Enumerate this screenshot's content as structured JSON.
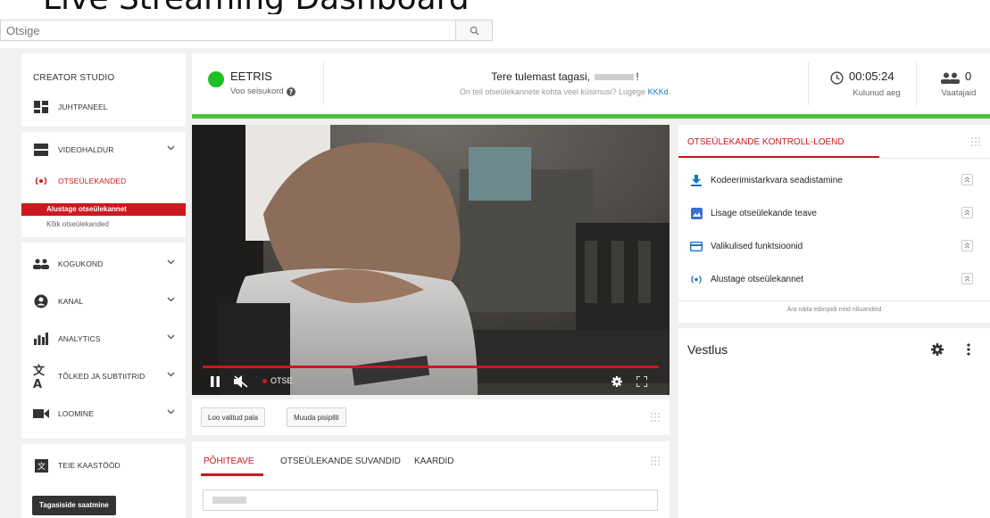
{
  "browser": {
    "page_heading": "Live Streaming Dashboard",
    "search": {
      "value": "Otsige",
      "placeholder": "Otsige"
    }
  },
  "sidebar": {
    "title": "CREATOR STUDIO",
    "items": [
      {
        "label": "JUHTPANEEL",
        "icon": "dashboard-icon"
      },
      {
        "label": "VIDEOHALDUR",
        "icon": "video-manager-icon",
        "expandable": true
      },
      {
        "label": "OTSEÜLEKANDED",
        "icon": "live-broadcast-icon",
        "active": true
      },
      {
        "label": "KOGUKOND",
        "icon": "community-icon",
        "expandable": true
      },
      {
        "label": "KANAL",
        "icon": "channel-icon",
        "expandable": true
      },
      {
        "label": "ANALYTICS",
        "icon": "analytics-icon",
        "expandable": true
      },
      {
        "label": "TÕLKED JA SUBTIITRID",
        "icon": "translate-icon",
        "expandable": true
      },
      {
        "label": "LOOMINE",
        "icon": "create-icon",
        "expandable": true
      },
      {
        "label": "TEIE KAASTÖÖD",
        "icon": "contributions-icon"
      }
    ],
    "subitems": {
      "active": "Alustage otseülekannet",
      "other": "Kõik otseülekanded"
    },
    "feedback_button": "Tagasiside saatmine"
  },
  "status_bar": {
    "live_label": "EETRIS",
    "stream_status_label": "Voo seisukord",
    "welcome": "Tere tulemast tagasi,",
    "welcome_suffix": "!",
    "help_text": "On teil otseülekannete kohta veel küsimusi? Lugege",
    "help_link": "KKKd",
    "help_tail": ".",
    "elapsed_time": "00:05:24",
    "elapsed_label": "Kulunud aeg",
    "viewer_count": "0",
    "viewers_label": "Vaatajaid",
    "live_color": "#1fc022"
  },
  "player": {
    "live_badge": "OTSE",
    "accent": "#cc181e"
  },
  "actions": {
    "clip_button": "Loo valitud pala",
    "thumbnail_button": "Muuda pisipilti"
  },
  "tabs": [
    {
      "label": "PÕHITEAVE",
      "active": true
    },
    {
      "label": "OTSEÜLEKANDE SUVANDID",
      "active": false
    },
    {
      "label": "KAARDID",
      "active": false
    }
  ],
  "checklist": {
    "title": "OTSEÜLEKANDE KONTROLL-LOEND",
    "items": [
      {
        "label": "Kodeerimistarkvara seadistamine",
        "icon": "download-icon"
      },
      {
        "label": "Lisage otseülekande teave",
        "icon": "info-image-icon"
      },
      {
        "label": "Valikulised funktsioonid",
        "icon": "card-icon"
      },
      {
        "label": "Alustage otseülekannet",
        "icon": "live-broadcast-icon"
      }
    ],
    "dismiss_text": "Ära näita edaspidi neid nõuandeid"
  },
  "chat": {
    "title": "Vestlus"
  }
}
